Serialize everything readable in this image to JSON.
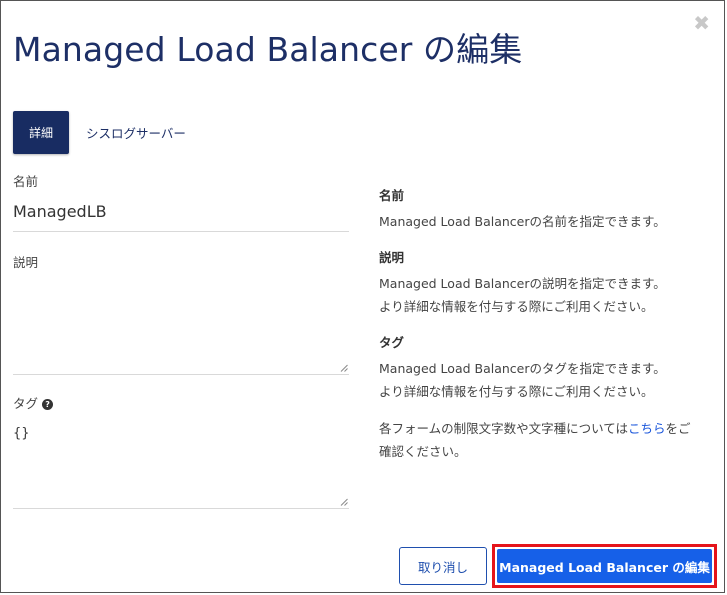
{
  "dialog": {
    "title": "Managed Load Balancer の編集",
    "close_icon": "close-icon"
  },
  "tabs": [
    {
      "label": "詳細",
      "active": true
    },
    {
      "label": "シスログサーバー",
      "active": false
    }
  ],
  "form": {
    "name_label": "名前",
    "name_value": "ManagedLB",
    "description_label": "説明",
    "description_value": "",
    "tags_label": "タグ",
    "tags_help_icon": "question-circle-icon",
    "tags_value": "{}"
  },
  "help": {
    "name_heading": "名前",
    "name_text": "Managed Load Balancerの名前を指定できます。",
    "description_heading": "説明",
    "description_text_1": "Managed Load Balancerの説明を指定できます。",
    "description_text_2": "より詳細な情報を付与する際にご利用ください。",
    "tags_heading": "タグ",
    "tags_text_1": "Managed Load Balancerのタグを指定できます。",
    "tags_text_2": "より詳細な情報を付与する際にご利用ください。",
    "limits_text_before": "各フォームの制限文字数や文字種については",
    "limits_link": "こちら",
    "limits_text_after_1": "をご",
    "limits_text_after_2": "確認ください。"
  },
  "buttons": {
    "cancel": "取り消し",
    "submit": "Managed Load Balancer の編集"
  },
  "colors": {
    "title": "#1d2f66",
    "active_tab": "#182c62",
    "primary_button": "#1660e8",
    "highlight_border": "#e5141b",
    "link": "#1a56db"
  }
}
